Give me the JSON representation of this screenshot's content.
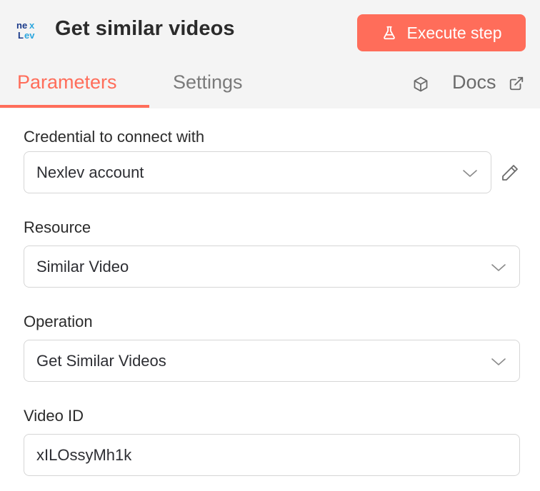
{
  "header": {
    "title": "Get similar videos",
    "execute_label": "Execute step",
    "logo_icon": "nexlev-logo",
    "accent": "#ff6d5a"
  },
  "tabs": [
    {
      "label": "Parameters",
      "active": true
    },
    {
      "label": "Settings",
      "active": false
    }
  ],
  "docs_label": "Docs",
  "fields": {
    "credential": {
      "label": "Credential to connect with",
      "value": "Nexlev account"
    },
    "resource": {
      "label": "Resource",
      "value": "Similar Video"
    },
    "operation": {
      "label": "Operation",
      "value": "Get Similar Videos"
    },
    "video_id": {
      "label": "Video ID",
      "value": "xILOssyMh1k"
    }
  }
}
